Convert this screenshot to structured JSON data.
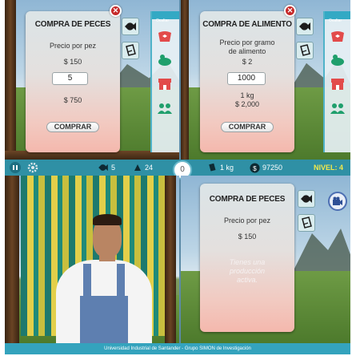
{
  "panels": {
    "fish_purchase": {
      "title": "COMPRA DE PECES",
      "price_label": "Precio por pez",
      "price_value": "$ 150",
      "quantity": "5",
      "total": "$ 750",
      "buy_label": "COMPRAR"
    },
    "food_purchase": {
      "title": "COMPRA DE ALIMENTO",
      "price_label_line1": "Precio por gramo",
      "price_label_line2": "de alimento",
      "price_value": "$ 2",
      "quantity": "1000",
      "amount": "1 kg",
      "total": "$ 2,000",
      "buy_label": "COMPRAR"
    },
    "fish_purchase_blocked": {
      "title": "COMPRA DE PECES",
      "price_label": "Precio por pez",
      "price_value": "$ 150",
      "note_line1": "Tienes una",
      "note_line2": "producción",
      "note_line3": "activa."
    }
  },
  "toolbar": {
    "header": "Ocultar"
  },
  "hud": {
    "fish_count": "5",
    "feed_count": "24",
    "center_value": "0",
    "food_stock": "1 kg",
    "money": "97250",
    "level": "NIVEL: 4"
  },
  "footer": {
    "text": "Universidad Industrial de Santander - Grupo SIMON de Investigación"
  },
  "colors": {
    "hud_bar": "#2f90a5",
    "close_button": "#c62a2a",
    "level_text": "#f3e94a"
  }
}
